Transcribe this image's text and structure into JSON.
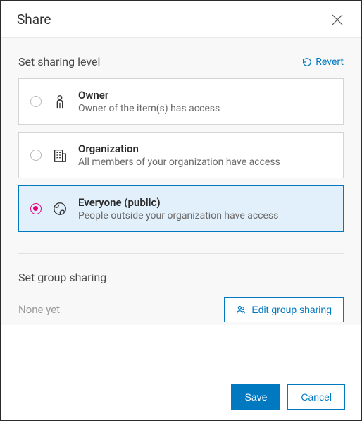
{
  "header": {
    "title": "Share"
  },
  "sharing": {
    "title": "Set sharing level",
    "revert": "Revert",
    "selected": 2,
    "options": [
      {
        "label": "Owner",
        "desc": "Owner of the item(s) has access"
      },
      {
        "label": "Organization",
        "desc": "All members of your organization have access"
      },
      {
        "label": "Everyone (public)",
        "desc": "People outside your organization have access"
      }
    ]
  },
  "group": {
    "title": "Set group sharing",
    "none_text": "None yet",
    "edit_label": "Edit group sharing"
  },
  "footer": {
    "save": "Save",
    "cancel": "Cancel"
  }
}
